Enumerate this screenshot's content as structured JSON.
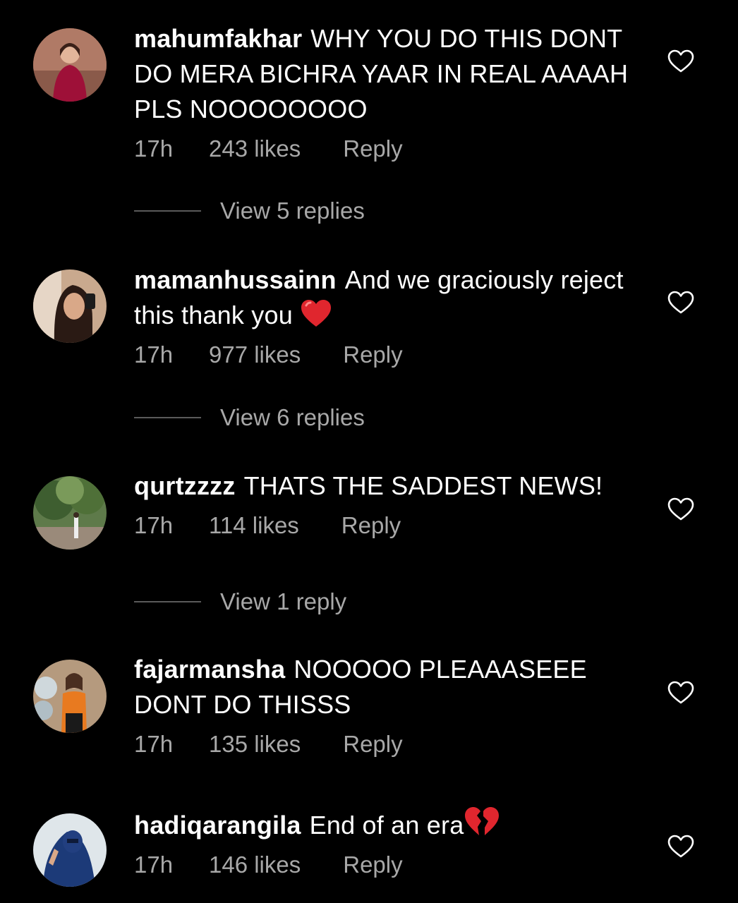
{
  "comments": [
    {
      "username": "mahumfakhar",
      "text": "WHY YOU DO THIS DONT DO MERA BICHRA YAAR IN REAL AAAAH PLS NOOOOOOOO",
      "time": "17h",
      "likes": "243 likes",
      "reply": "Reply",
      "view_replies": "View 5 replies"
    },
    {
      "username": "mamanhussainn",
      "text": "And we graciously reject this thank you",
      "emoji": "red-heart",
      "time": "17h",
      "likes": "977 likes",
      "reply": "Reply",
      "view_replies": "View 6 replies"
    },
    {
      "username": "qurtzzzz",
      "text": "THATS THE SADDEST NEWS!",
      "time": "17h",
      "likes": "114 likes",
      "reply": "Reply",
      "view_replies": "View 1 reply"
    },
    {
      "username": "fajarmansha",
      "text": "NOOOOO PLEAAASEEE DONT DO THISSS",
      "time": "17h",
      "likes": "135 likes",
      "reply": "Reply"
    },
    {
      "username": "hadiqarangila",
      "text": "End of an era",
      "emoji": "broken-heart",
      "time": "17h",
      "likes": "146 likes",
      "reply": "Reply"
    }
  ],
  "colors": {
    "background": "#000000",
    "primary_text": "#ffffff",
    "secondary_text": "#a8a8a8",
    "divider": "#5a5a5a"
  },
  "icons": {
    "like": "heart-outline-icon"
  }
}
